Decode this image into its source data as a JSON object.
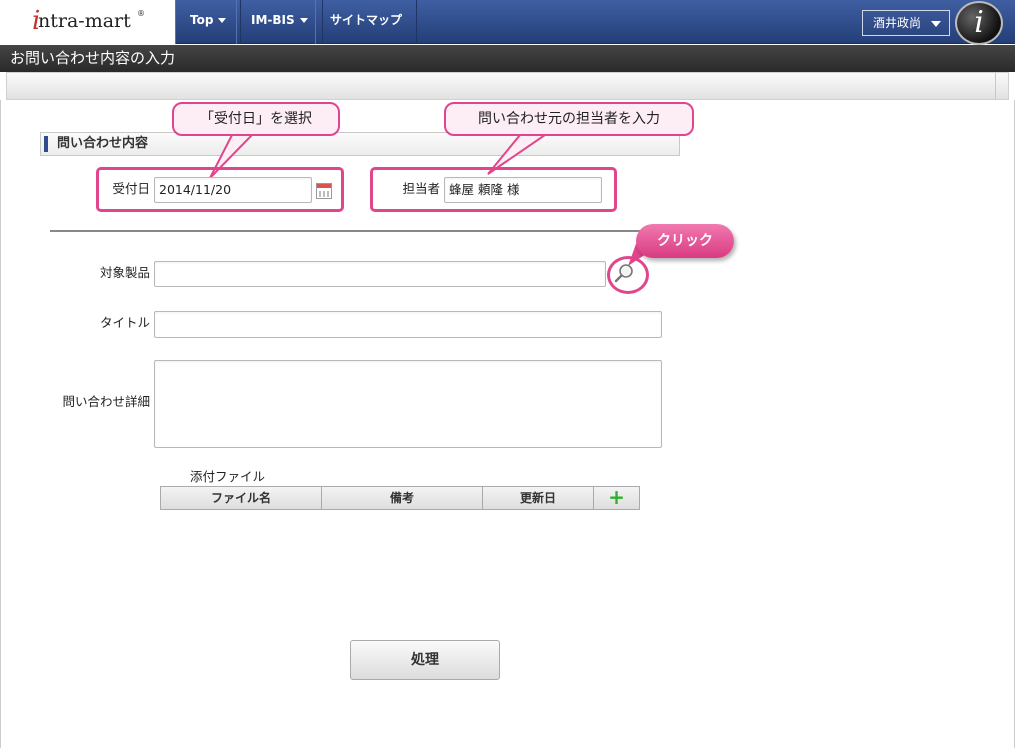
{
  "header": {
    "logo_text": "ntra-mart",
    "logo_i": "i",
    "logo_reg": "®",
    "nav": [
      {
        "label": "Top",
        "has_dropdown": true
      },
      {
        "label": "IM-BIS",
        "has_dropdown": true
      },
      {
        "label": "サイトマップ",
        "has_dropdown": false
      }
    ],
    "user_name": "酒井政尚",
    "avatar_letter": "i"
  },
  "page": {
    "title": "お問い合わせ内容の入力"
  },
  "section": {
    "title": "問い合わせ内容"
  },
  "form": {
    "date_label": "受付日",
    "date_value": "2014/11/20",
    "person_label": "担当者",
    "person_value": "蜂屋 頼隆 様",
    "product_label": "対象製品",
    "product_value": "",
    "title_label": "タイトル",
    "title_value": "",
    "detail_label": "問い合わせ詳細",
    "detail_value": ""
  },
  "attachments": {
    "label": "添付ファイル",
    "columns": [
      "ファイル名",
      "備考",
      "更新日"
    ],
    "add_icon": "+"
  },
  "annotations": {
    "date_hint": "「受付日」を選択",
    "person_hint": "問い合わせ元の担当者を入力",
    "click_hint": "クリック"
  },
  "actions": {
    "process_label": "処理"
  },
  "colors": {
    "nav_bg": "#2f4c8a",
    "highlight": "#e0468c",
    "title_bar": "#333333"
  }
}
